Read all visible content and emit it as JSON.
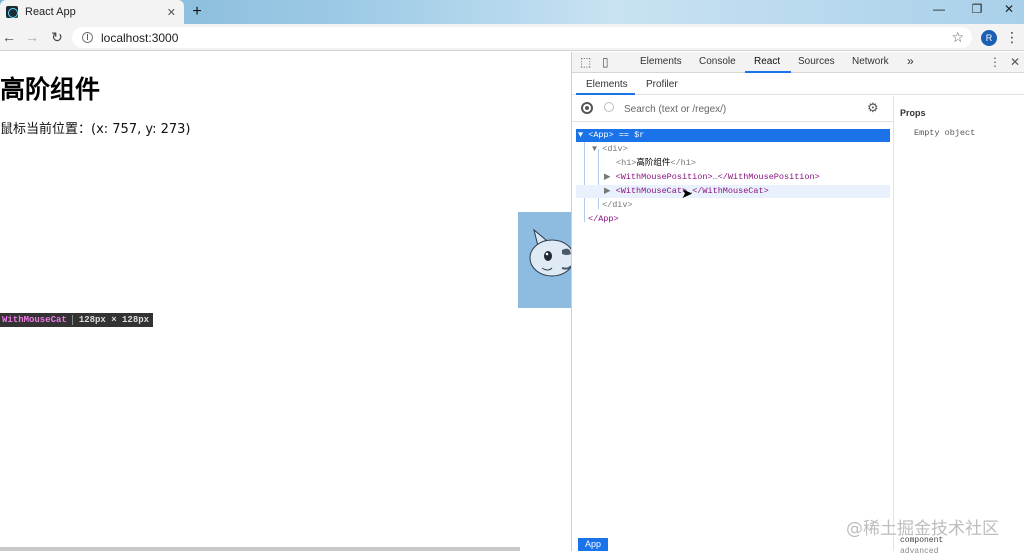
{
  "browser": {
    "tab_title": "React App",
    "tab_close": "✕",
    "new_tab": "+",
    "window_controls": [
      "—",
      "❐",
      "✕"
    ],
    "url": "localhost:3000",
    "ext_label": "R",
    "star": "☆",
    "menu": "⋮"
  },
  "page": {
    "heading": "高阶组件",
    "mouse_position": "鼠标当前位置：(x: 757, y: 273)",
    "tooltip_name": "WithMouseCat",
    "tooltip_size": "128px × 128px"
  },
  "devtools": {
    "tabs": [
      "Elements",
      "Console",
      "React",
      "Sources",
      "Network"
    ],
    "active_tab": "React",
    "more": "»",
    "subtabs": [
      "Elements",
      "Profiler"
    ],
    "search_placeholder": "Search (text or /regex/)",
    "tree": [
      {
        "arrow": "▼",
        "open": "<App>",
        "suffix": " == $r",
        "close": ""
      },
      {
        "arrow": "▼",
        "open": "<div>",
        "suffix": "",
        "close": ""
      },
      {
        "arrow": "",
        "open": "<h1>",
        "text": "高阶组件",
        "close": "</h1>"
      },
      {
        "arrow": "▶",
        "open": "<WithMousePosition>",
        "text": "…",
        "close": "</WithMousePosition>"
      },
      {
        "arrow": "▶",
        "open": "<WithMouseCat>",
        "text": "…",
        "close": "</WithMouseCat>"
      },
      {
        "arrow": "",
        "open": "</div>",
        "close": ""
      },
      {
        "arrow": "",
        "open": "</App>",
        "close": ""
      }
    ],
    "props_title": "Props",
    "props_value": "Empty object",
    "bottom_lines": [
      "component",
      "advanced"
    ],
    "breadcrumb_app": "App"
  },
  "watermark": "@稀土掘金技术社区"
}
